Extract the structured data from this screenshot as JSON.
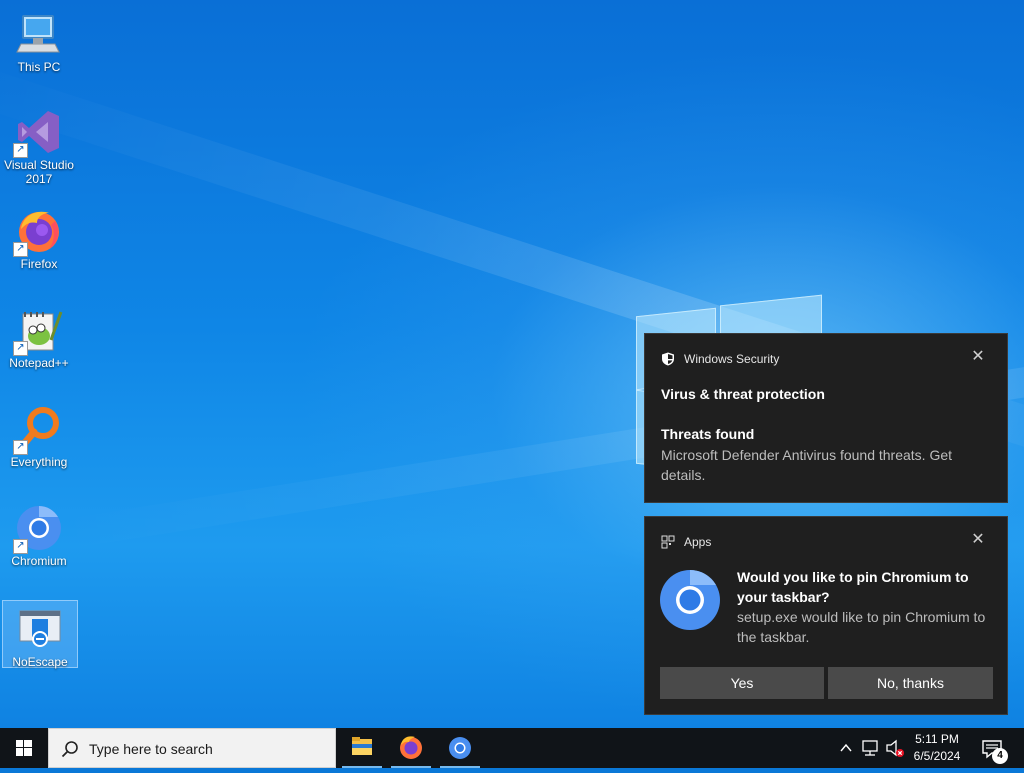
{
  "desktop": {
    "icons": [
      {
        "label": "This PC",
        "icon": "this-pc-icon"
      },
      {
        "label": "Visual Studio 2017",
        "icon": "visual-studio-icon"
      },
      {
        "label": "Firefox",
        "icon": "firefox-icon"
      },
      {
        "label": "Notepad++",
        "icon": "notepadpp-icon"
      },
      {
        "label": "Everything",
        "icon": "everything-icon"
      },
      {
        "label": "Chromium",
        "icon": "chromium-icon"
      },
      {
        "label": "NoEscape",
        "icon": "noescape-icon"
      }
    ]
  },
  "toasts": [
    {
      "app": "Windows Security",
      "title": "Virus & threat protection",
      "subtitle": "Threats found",
      "body": "Microsoft Defender Antivirus found threats. Get details.",
      "close": "✕"
    },
    {
      "app": "Apps",
      "title": "Would you like to pin Chromium to your taskbar?",
      "body": "setup.exe would like to pin Chromium to the taskbar.",
      "yes_label": "Yes",
      "no_label": "No, thanks",
      "close": "✕"
    }
  ],
  "taskbar": {
    "search_placeholder": "Type here to search",
    "pinned": [
      "file-explorer-icon",
      "firefox-icon",
      "chromium-icon"
    ],
    "tray": {
      "chevron": "^",
      "time": "5:11 PM",
      "date": "6/5/2024",
      "notification_count": "4"
    }
  },
  "colors": {
    "toast_bg": "#1f1f1f",
    "button_bg": "#4a4a4a",
    "taskbar_bg": "#101418",
    "accent": "#0078d7"
  }
}
